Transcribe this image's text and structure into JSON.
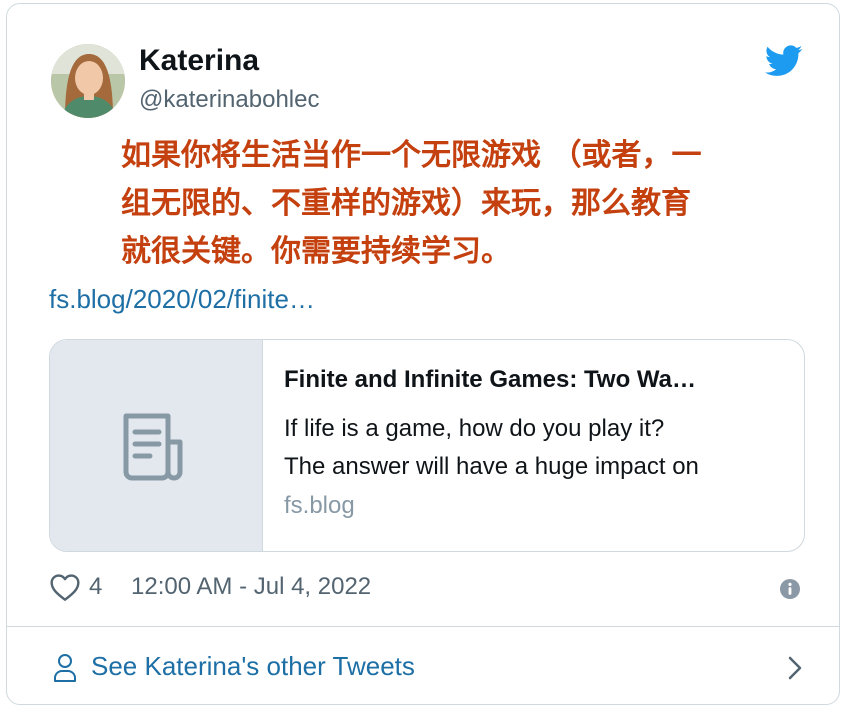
{
  "author": {
    "display_name": "Katerina",
    "handle": "@katerinabohlec",
    "avatar_icon": "avatar-photo"
  },
  "brand": {
    "icon": "twitter-bird-icon",
    "color": "#1d9bf0"
  },
  "tweet": {
    "text_lines": [
      "如果你将生活当作一个无限游戏 （或者，一",
      "组无限的、不重样的游戏）来玩，那么教育",
      "就很关键。你需要持续学习。"
    ],
    "text_color": "#c4400f",
    "link": "fs.blog/2020/02/finite…"
  },
  "preview": {
    "title": "Finite and Infinite Games: Two Wa…",
    "description_lines": [
      "If life is a game, how do you play it?",
      "The answer will have a huge impact on"
    ],
    "domain": "fs.blog",
    "media_icon": "document-icon"
  },
  "meta": {
    "like_count": "4",
    "timestamp": "12:00 AM - Jul 4, 2022",
    "like_icon": "heart-icon",
    "info_icon": "info-icon"
  },
  "footer": {
    "label": "See Katerina's other Tweets",
    "icon": "person-icon",
    "chevron": "chevron-right-icon"
  }
}
